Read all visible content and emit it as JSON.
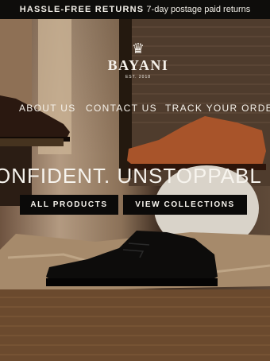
{
  "announcement": {
    "bold": "HASSLE-FREE RETURNS",
    "text": "7-day postage paid returns"
  },
  "logo": {
    "brand": "BAYANI",
    "est": "EST. 2018",
    "icon": "crown-icon"
  },
  "nav": {
    "items": [
      "ABOUT US",
      "CONTACT US",
      "TRACK YOUR ORDER"
    ]
  },
  "hero": {
    "headline": "ONFIDENT. UNSTOPPABL",
    "buttons": [
      "ALL PRODUCTS",
      "VIEW COLLECTIONS"
    ]
  },
  "colors": {
    "accent": "#0b0a09",
    "text_light": "#f7f4ee"
  }
}
